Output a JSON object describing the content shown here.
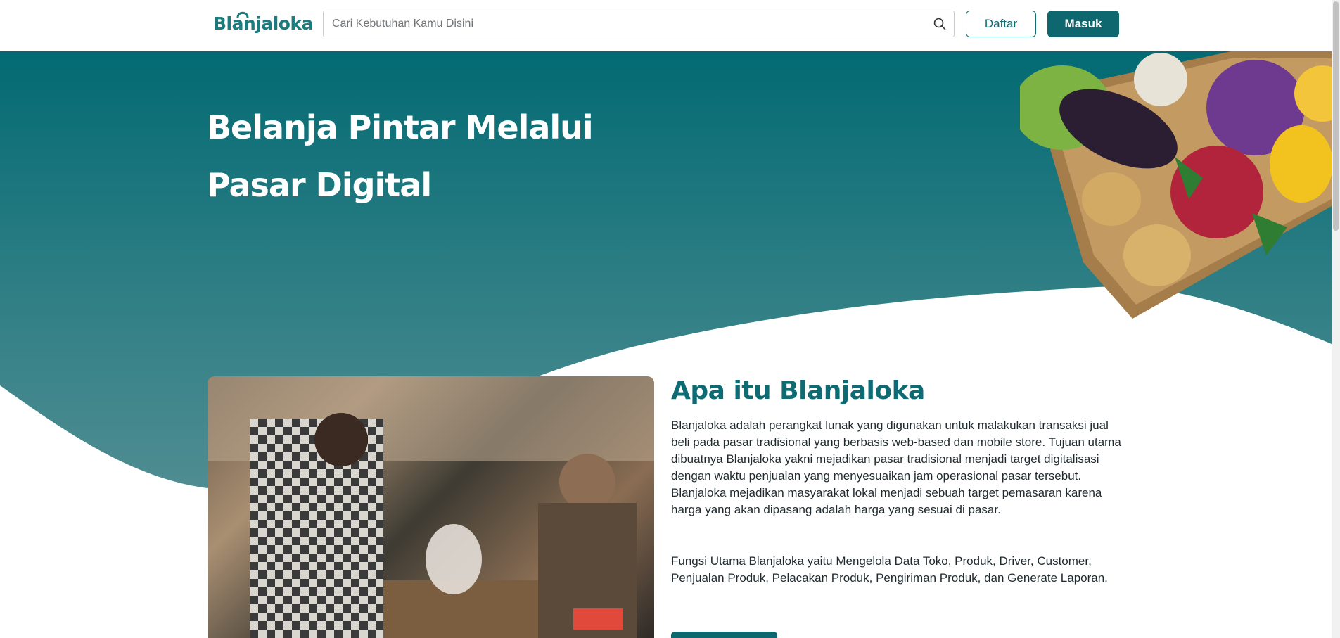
{
  "header": {
    "logo_text": "Blanjaloka",
    "search": {
      "placeholder": "Cari Kebutuhan Kamu Disini",
      "value": ""
    },
    "register_label": "Daftar",
    "login_label": "Masuk"
  },
  "hero": {
    "title_line1": "Belanja Pintar Melalui",
    "title_line2": "Pasar Digital"
  },
  "about": {
    "title": "Apa itu Blanjaloka",
    "paragraph1": "Blanjaloka adalah perangkat lunak yang digunakan untuk malakukan transaksi jual beli pada pasar tradisional yang berbasis web-based dan mobile store. Tujuan utama dibuatnya Blanjaloka yakni mejadikan pasar tradisional menjadi target digitalisasi dengan waktu penjualan yang menyesuaikan jam operasional pasar tersebut. Blanjaloka mejadikan masyarakat lokal menjadi sebuah target pemasaran karena harga yang akan dipasang adalah harga yang sesuai di pasar.",
    "paragraph2": "Fungsi Utama Blanjaloka yaitu Mengelola Data Toko, Produk, Driver, Customer, Penjualan Produk, Pelacakan Produk, Pengiriman Produk, dan Generate Laporan."
  },
  "colors": {
    "brand": "#0e676e",
    "brand_light": "#1b7c80",
    "hero_top": "#046b74",
    "hero_bottom": "#4a8b90"
  },
  "icons": {
    "search": "search-icon",
    "logo_bag": "shopping-bag-icon"
  }
}
